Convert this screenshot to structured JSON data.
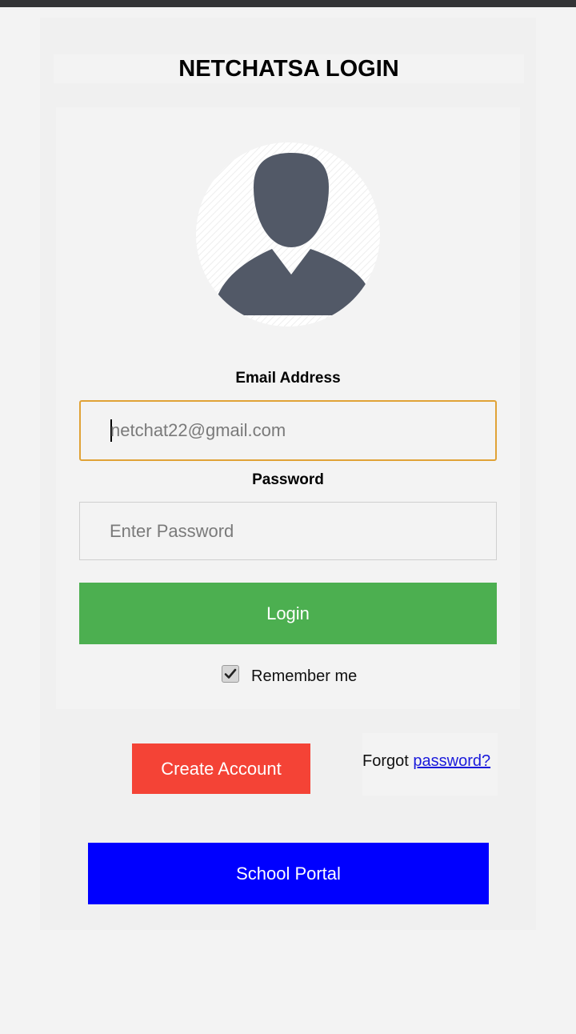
{
  "header": {
    "title": "NETCHATSA LOGIN"
  },
  "form": {
    "email_label": "Email Address",
    "email_value": "netchat22@gmail.com",
    "password_label": "Password",
    "password_placeholder": "Enter Password",
    "login_label": "Login",
    "remember_label": "Remember me",
    "remember_checked": true
  },
  "footer": {
    "create_account_label": "Create Account",
    "forgot_prefix": "Forgot",
    "forgot_link": "password?",
    "school_portal_label": "School Portal"
  },
  "colors": {
    "login_button": "#4caf50",
    "create_account_button": "#f44336",
    "school_portal_button": "#0000ff",
    "email_focus_border": "#e0a236",
    "avatar_fill": "#525967"
  },
  "icons": {
    "avatar": "user-silhouette-icon",
    "checkbox": "checkmark-icon"
  }
}
